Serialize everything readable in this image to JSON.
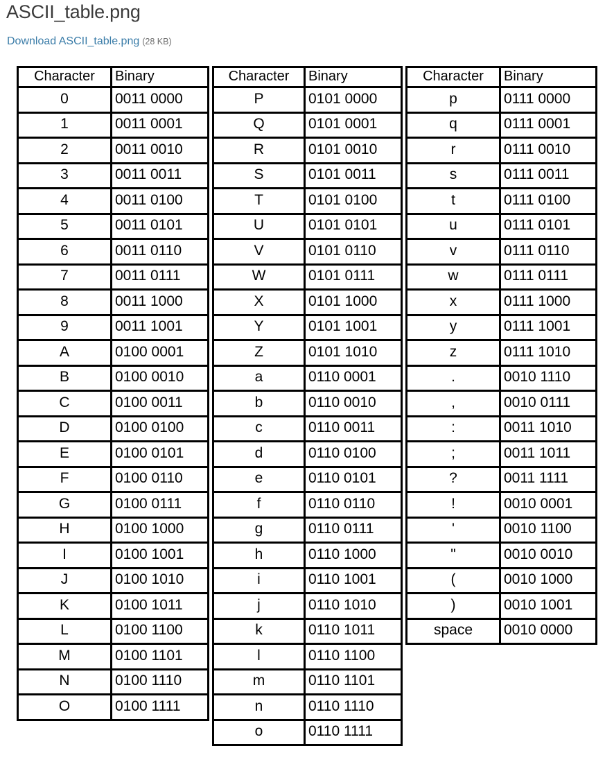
{
  "page": {
    "title": "ASCII_table.png",
    "download_label": "Download ASCII_table.png",
    "file_size": "(28 KB)",
    "link_color": "#3a7ca8",
    "title_color": "#3b3b3b",
    "size_color": "#6f6f6f"
  },
  "table": {
    "headers": [
      "Character",
      "Binary"
    ],
    "columns": [
      {
        "rows": [
          {
            "character": "0",
            "binary": "0011 0000"
          },
          {
            "character": "1",
            "binary": "0011 0001"
          },
          {
            "character": "2",
            "binary": "0011 0010"
          },
          {
            "character": "3",
            "binary": "0011 0011"
          },
          {
            "character": "4",
            "binary": "0011 0100"
          },
          {
            "character": "5",
            "binary": "0011 0101"
          },
          {
            "character": "6",
            "binary": "0011 0110"
          },
          {
            "character": "7",
            "binary": "0011 0111"
          },
          {
            "character": "8",
            "binary": "0011 1000"
          },
          {
            "character": "9",
            "binary": "0011 1001"
          },
          {
            "character": "A",
            "binary": "0100 0001"
          },
          {
            "character": "B",
            "binary": "0100 0010"
          },
          {
            "character": "C",
            "binary": "0100 0011"
          },
          {
            "character": "D",
            "binary": "0100 0100"
          },
          {
            "character": "E",
            "binary": "0100 0101"
          },
          {
            "character": "F",
            "binary": "0100 0110"
          },
          {
            "character": "G",
            "binary": "0100 0111"
          },
          {
            "character": "H",
            "binary": "0100 1000"
          },
          {
            "character": "I",
            "binary": "0100 1001"
          },
          {
            "character": "J",
            "binary": "0100 1010"
          },
          {
            "character": "K",
            "binary": "0100 1011"
          },
          {
            "character": "L",
            "binary": "0100 1100"
          },
          {
            "character": "M",
            "binary": "0100 1101"
          },
          {
            "character": "N",
            "binary": "0100 1110"
          },
          {
            "character": "O",
            "binary": "0100 1111"
          }
        ]
      },
      {
        "rows": [
          {
            "character": "P",
            "binary": "0101 0000"
          },
          {
            "character": "Q",
            "binary": "0101 0001"
          },
          {
            "character": "R",
            "binary": "0101 0010"
          },
          {
            "character": "S",
            "binary": "0101 0011"
          },
          {
            "character": "T",
            "binary": "0101 0100"
          },
          {
            "character": "U",
            "binary": "0101 0101"
          },
          {
            "character": "V",
            "binary": "0101 0110"
          },
          {
            "character": "W",
            "binary": "0101 0111"
          },
          {
            "character": "X",
            "binary": "0101 1000"
          },
          {
            "character": "Y",
            "binary": "0101 1001"
          },
          {
            "character": "Z",
            "binary": "0101 1010"
          },
          {
            "character": "a",
            "binary": "0110 0001"
          },
          {
            "character": "b",
            "binary": "0110 0010"
          },
          {
            "character": "c",
            "binary": "0110 0011"
          },
          {
            "character": "d",
            "binary": "0110 0100"
          },
          {
            "character": "e",
            "binary": "0110 0101"
          },
          {
            "character": "f",
            "binary": "0110 0110"
          },
          {
            "character": "g",
            "binary": "0110 0111"
          },
          {
            "character": "h",
            "binary": "0110 1000"
          },
          {
            "character": "i",
            "binary": "0110 1001"
          },
          {
            "character": "j",
            "binary": "0110 1010"
          },
          {
            "character": "k",
            "binary": "0110 1011"
          },
          {
            "character": "l",
            "binary": "0110 1100"
          },
          {
            "character": "m",
            "binary": "0110 1101"
          },
          {
            "character": "n",
            "binary": "0110 1110"
          },
          {
            "character": "o",
            "binary": "0110 1111"
          }
        ]
      },
      {
        "rows": [
          {
            "character": "p",
            "binary": "0111 0000"
          },
          {
            "character": "q",
            "binary": "0111 0001"
          },
          {
            "character": "r",
            "binary": "0111 0010"
          },
          {
            "character": "s",
            "binary": "0111 0011"
          },
          {
            "character": "t",
            "binary": "0111 0100"
          },
          {
            "character": "u",
            "binary": "0111 0101"
          },
          {
            "character": "v",
            "binary": "0111 0110"
          },
          {
            "character": "w",
            "binary": "0111 0111"
          },
          {
            "character": "x",
            "binary": "0111 1000"
          },
          {
            "character": "y",
            "binary": "0111 1001"
          },
          {
            "character": "z",
            "binary": "0111 1010"
          },
          {
            "character": ".",
            "binary": "0010 1110"
          },
          {
            "character": ",",
            "binary": "0010 0111"
          },
          {
            "character": ":",
            "binary": "0011 1010"
          },
          {
            "character": ";",
            "binary": "0011 1011"
          },
          {
            "character": "?",
            "binary": "0011 1111"
          },
          {
            "character": "!",
            "binary": "0010 0001"
          },
          {
            "character": "'",
            "binary": "0010 1100"
          },
          {
            "character": "\"",
            "binary": "0010 0010"
          },
          {
            "character": "(",
            "binary": "0010 1000"
          },
          {
            "character": ")",
            "binary": "0010 1001"
          },
          {
            "character": "space",
            "binary": "0010 0000"
          }
        ]
      }
    ]
  }
}
